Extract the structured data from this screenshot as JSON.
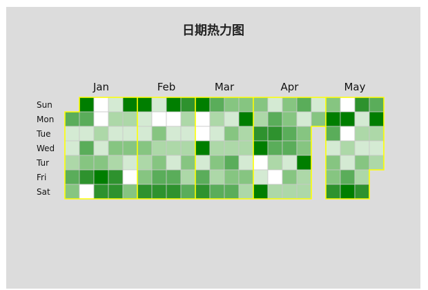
{
  "chart_data": {
    "type": "heatmap",
    "title": "日期热力图",
    "months": [
      "Jan",
      "Feb",
      "Mar",
      "Apr",
      "May"
    ],
    "weekdays": [
      "Sun",
      "Mon",
      "Tue",
      "Wed",
      "Tur",
      "Fri",
      "Sat"
    ],
    "scale": [
      "#ffffff",
      "#d4ead3",
      "#add8a8",
      "#86c581",
      "#5aad5a",
      "#2e922e",
      "#007e00"
    ],
    "weeks": [
      {
        "month": 0,
        "levels": [
          null,
          4,
          1,
          1,
          2,
          4,
          3
        ]
      },
      {
        "month": 0,
        "levels": [
          6,
          4,
          1,
          4,
          3,
          5,
          0
        ]
      },
      {
        "month": 0,
        "levels": [
          0,
          0,
          2,
          1,
          3,
          6,
          5
        ]
      },
      {
        "month": 0,
        "levels": [
          1,
          2,
          1,
          3,
          2,
          5,
          5
        ]
      },
      {
        "month": 0,
        "levels": [
          6,
          2,
          1,
          3,
          1,
          0,
          3
        ]
      },
      {
        "month": 1,
        "levels": [
          6,
          1,
          1,
          3,
          2,
          3,
          5
        ]
      },
      {
        "month": 1,
        "levels": [
          1,
          0,
          3,
          2,
          3,
          4,
          5
        ]
      },
      {
        "month": 1,
        "levels": [
          6,
          0,
          1,
          2,
          1,
          4,
          5
        ]
      },
      {
        "month": 1,
        "levels": [
          5,
          2,
          1,
          2,
          3,
          2,
          4
        ]
      },
      {
        "month": 2,
        "levels": [
          6,
          0,
          0,
          6,
          1,
          4,
          5
        ]
      },
      {
        "month": 2,
        "levels": [
          4,
          2,
          1,
          2,
          3,
          2,
          4
        ]
      },
      {
        "month": 2,
        "levels": [
          3,
          1,
          3,
          2,
          4,
          3,
          4
        ]
      },
      {
        "month": 2,
        "levels": [
          3,
          6,
          2,
          2,
          1,
          3,
          2
        ]
      },
      {
        "month": 3,
        "levels": [
          3,
          2,
          5,
          6,
          0,
          1,
          6
        ]
      },
      {
        "month": 3,
        "levels": [
          1,
          4,
          5,
          4,
          2,
          0,
          2
        ]
      },
      {
        "month": 3,
        "levels": [
          3,
          3,
          4,
          4,
          1,
          3,
          2
        ]
      },
      {
        "month": 3,
        "levels": [
          4,
          1,
          3,
          3,
          6,
          2,
          2
        ]
      },
      {
        "month": 3,
        "levels": [
          1,
          3,
          null,
          null,
          null,
          null,
          null
        ]
      },
      {
        "month": 4,
        "levels": [
          3,
          6,
          4,
          1,
          3,
          3,
          5
        ]
      },
      {
        "month": 4,
        "levels": [
          0,
          6,
          0,
          2,
          1,
          4,
          6
        ]
      },
      {
        "month": 4,
        "levels": [
          5,
          1,
          2,
          1,
          3,
          2,
          5
        ]
      },
      {
        "month": 4,
        "levels": [
          4,
          6,
          2,
          1,
          2,
          null,
          null
        ]
      }
    ]
  }
}
